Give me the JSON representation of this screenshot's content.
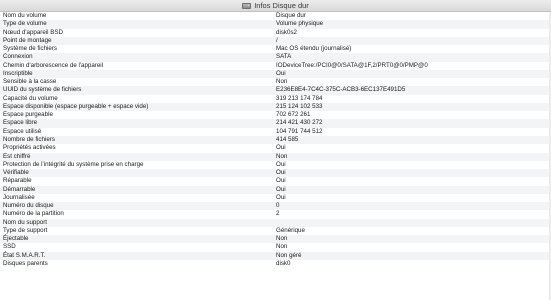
{
  "window": {
    "title": "Infos Disque dur",
    "icon": "hard-disk-icon"
  },
  "rows": [
    {
      "label": "Nom du volume",
      "value": "Disque dur"
    },
    {
      "label": "Type de volume",
      "value": "Volume physique"
    },
    {
      "label": "Nœud d'appareil BSD",
      "value": "disk0s2"
    },
    {
      "label": "Point de montage",
      "value": "/"
    },
    {
      "label": "Système de fichiers",
      "value": "Mac OS étendu (journalisé)"
    },
    {
      "label": "Connexion",
      "value": "SATA"
    },
    {
      "label": "Chemin d'arborescence de l'appareil",
      "value": "IODeviceTree:/PCI0@0/SATA@1F,2/PRT0@0/PMP@0"
    },
    {
      "label": "Inscriptible",
      "value": "Oui"
    },
    {
      "label": "Sensible à la casse",
      "value": "Non"
    },
    {
      "label": "UUID du système de fichiers",
      "value": "E236E8E4-7C4C-375C-ACB3-6EC137E491D5"
    },
    {
      "label": "Capacité du volume",
      "value": "319 213 174 784"
    },
    {
      "label": "Espace disponible (espace purgeable + espace vide)",
      "value": "215 124 102 533"
    },
    {
      "label": "Espace purgeable",
      "value": "702 672 261"
    },
    {
      "label": "Espace libre",
      "value": "214 421 430 272"
    },
    {
      "label": "Espace utilisé",
      "value": "104 791 744 512"
    },
    {
      "label": "Nombre de fichiers",
      "value": "414 585"
    },
    {
      "label": "Propriétés activées",
      "value": "Oui"
    },
    {
      "label": "Est chiffré",
      "value": "Non"
    },
    {
      "label": "Protection de l'intégrité du système prise en charge",
      "value": "Oui"
    },
    {
      "label": "Vérifiable",
      "value": "Oui"
    },
    {
      "label": "Réparable",
      "value": "Oui"
    },
    {
      "label": "Démarrable",
      "value": "Oui"
    },
    {
      "label": "Journalisée",
      "value": "Oui"
    },
    {
      "label": "Numéro du disque",
      "value": "0"
    },
    {
      "label": "Numéro de la partition",
      "value": "2"
    },
    {
      "label": "Nom du support",
      "value": ""
    },
    {
      "label": "Type de support",
      "value": "Générique"
    },
    {
      "label": "Éjectable",
      "value": "Non"
    },
    {
      "label": "SSD",
      "value": "Non"
    },
    {
      "label": "État S.M.A.R.T.",
      "value": "Non géré"
    },
    {
      "label": "Disques parents",
      "value": "disk0"
    }
  ]
}
